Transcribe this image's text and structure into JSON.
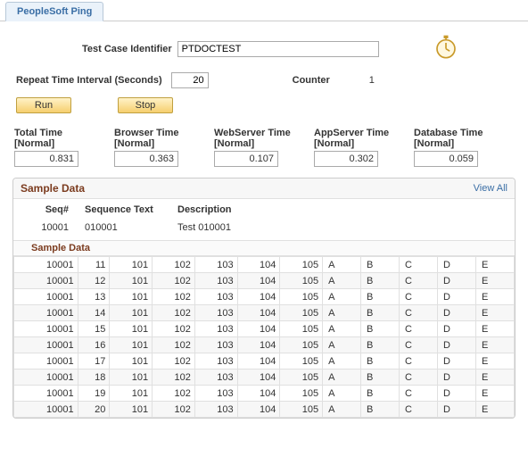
{
  "tab": {
    "label": "PeopleSoft Ping"
  },
  "form": {
    "testCaseLabel": "Test Case Identifier",
    "testCaseValue": "PTDOCTEST",
    "repeatLabel": "Repeat Time Interval (Seconds)",
    "repeatValue": "20",
    "counterLabel": "Counter",
    "counterValue": "1",
    "runLabel": "Run",
    "stopLabel": "Stop"
  },
  "metrics": [
    {
      "title": "Total Time",
      "sub": "[Normal]",
      "value": "0.831"
    },
    {
      "title": "Browser Time",
      "sub": "[Normal]",
      "value": "0.363"
    },
    {
      "title": "WebServer Time",
      "sub": "[Normal]",
      "value": "0.107"
    },
    {
      "title": "AppServer Time",
      "sub": "[Normal]",
      "value": "0.302"
    },
    {
      "title": "Database Time",
      "sub": "[Normal]",
      "value": "0.059"
    }
  ],
  "sample": {
    "title": "Sample Data",
    "viewAll": "View All",
    "headers": {
      "seq": "Seq#",
      "seqText": "Sequence Text",
      "desc": "Description"
    },
    "row": {
      "seq": "10001",
      "seqText": "010001",
      "desc": "Test 010001"
    },
    "innerTitle": "Sample Data",
    "rows": [
      {
        "c0": "10001",
        "c1": "11",
        "c2": "101",
        "c3": "102",
        "c4": "103",
        "c5": "104",
        "c6": "105",
        "c7": "A",
        "c8": "B",
        "c9": "C",
        "c10": "D",
        "c11": "E"
      },
      {
        "c0": "10001",
        "c1": "12",
        "c2": "101",
        "c3": "102",
        "c4": "103",
        "c5": "104",
        "c6": "105",
        "c7": "A",
        "c8": "B",
        "c9": "C",
        "c10": "D",
        "c11": "E"
      },
      {
        "c0": "10001",
        "c1": "13",
        "c2": "101",
        "c3": "102",
        "c4": "103",
        "c5": "104",
        "c6": "105",
        "c7": "A",
        "c8": "B",
        "c9": "C",
        "c10": "D",
        "c11": "E"
      },
      {
        "c0": "10001",
        "c1": "14",
        "c2": "101",
        "c3": "102",
        "c4": "103",
        "c5": "104",
        "c6": "105",
        "c7": "A",
        "c8": "B",
        "c9": "C",
        "c10": "D",
        "c11": "E"
      },
      {
        "c0": "10001",
        "c1": "15",
        "c2": "101",
        "c3": "102",
        "c4": "103",
        "c5": "104",
        "c6": "105",
        "c7": "A",
        "c8": "B",
        "c9": "C",
        "c10": "D",
        "c11": "E"
      },
      {
        "c0": "10001",
        "c1": "16",
        "c2": "101",
        "c3": "102",
        "c4": "103",
        "c5": "104",
        "c6": "105",
        "c7": "A",
        "c8": "B",
        "c9": "C",
        "c10": "D",
        "c11": "E"
      },
      {
        "c0": "10001",
        "c1": "17",
        "c2": "101",
        "c3": "102",
        "c4": "103",
        "c5": "104",
        "c6": "105",
        "c7": "A",
        "c8": "B",
        "c9": "C",
        "c10": "D",
        "c11": "E"
      },
      {
        "c0": "10001",
        "c1": "18",
        "c2": "101",
        "c3": "102",
        "c4": "103",
        "c5": "104",
        "c6": "105",
        "c7": "A",
        "c8": "B",
        "c9": "C",
        "c10": "D",
        "c11": "E"
      },
      {
        "c0": "10001",
        "c1": "19",
        "c2": "101",
        "c3": "102",
        "c4": "103",
        "c5": "104",
        "c6": "105",
        "c7": "A",
        "c8": "B",
        "c9": "C",
        "c10": "D",
        "c11": "E"
      },
      {
        "c0": "10001",
        "c1": "20",
        "c2": "101",
        "c3": "102",
        "c4": "103",
        "c5": "104",
        "c6": "105",
        "c7": "A",
        "c8": "B",
        "c9": "C",
        "c10": "D",
        "c11": "E"
      }
    ]
  }
}
